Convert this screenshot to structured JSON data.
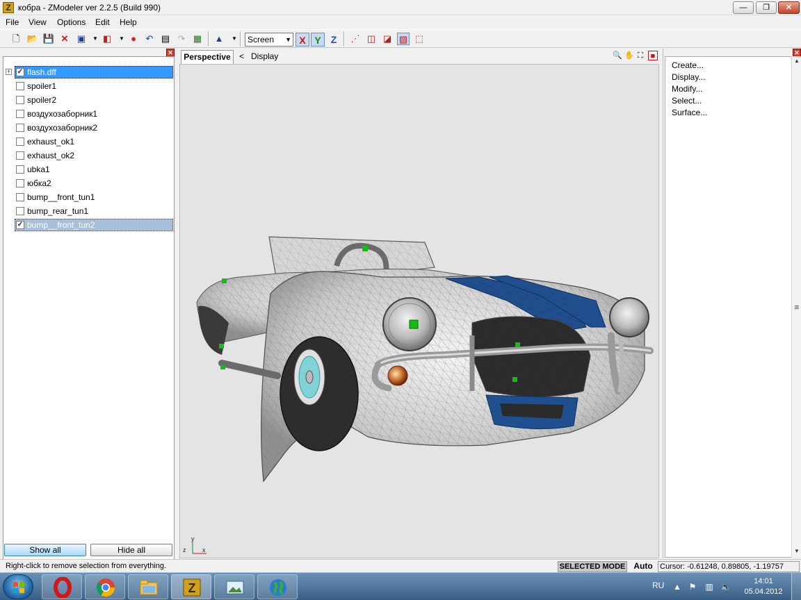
{
  "window": {
    "title": "кобра - ZModeler ver 2.2.5 (Build 990)",
    "app_icon_letter": "Z",
    "controls": {
      "minimize": "—",
      "maximize": "❐",
      "close": "✕"
    }
  },
  "menu": {
    "items": [
      {
        "label": "File"
      },
      {
        "label": "View"
      },
      {
        "label": "Options"
      },
      {
        "label": "Edit"
      },
      {
        "label": "Help"
      }
    ]
  },
  "toolbar": {
    "view_mode": "Screen",
    "axes": [
      "X",
      "Y",
      "Z"
    ]
  },
  "objects_panel": {
    "items": [
      {
        "label": "flash.dff",
        "checked": true,
        "expandable": true,
        "state": "selected"
      },
      {
        "label": "spoiler1",
        "checked": false,
        "expandable": false,
        "state": "none"
      },
      {
        "label": "spoiler2",
        "checked": false,
        "expandable": false,
        "state": "none"
      },
      {
        "label": "воздухозаборник1",
        "checked": false,
        "expandable": false,
        "state": "none"
      },
      {
        "label": "воздухозаборник2",
        "checked": false,
        "expandable": false,
        "state": "none"
      },
      {
        "label": "exhaust_ok1",
        "checked": false,
        "expandable": false,
        "state": "none"
      },
      {
        "label": "exhaust_ok2",
        "checked": false,
        "expandable": false,
        "state": "none"
      },
      {
        "label": "ubka1",
        "checked": false,
        "expandable": false,
        "state": "none"
      },
      {
        "label": "юбка2",
        "checked": false,
        "expandable": false,
        "state": "none"
      },
      {
        "label": "bump__front_tun1",
        "checked": false,
        "expandable": false,
        "state": "none"
      },
      {
        "label": "bump_rear_tun1",
        "checked": false,
        "expandable": false,
        "state": "none"
      },
      {
        "label": "bump__front_tun2",
        "checked": true,
        "expandable": false,
        "state": "highlighted"
      }
    ],
    "show_all_label": "Show all",
    "hide_all_label": "Hide all"
  },
  "viewport": {
    "tab_label": "Perspective",
    "back_label": "<",
    "breadcrumb": "Display",
    "gizmo_y": "y",
    "gizmo_z": "z",
    "gizmo_x": "x"
  },
  "command_panel": {
    "items": [
      {
        "label": "Create..."
      },
      {
        "label": "Display..."
      },
      {
        "label": "Modify..."
      },
      {
        "label": "Select..."
      },
      {
        "label": "Surface..."
      }
    ]
  },
  "status": {
    "hint": "Right-click to remove selection from everything.",
    "mode": "SELECTED MODE",
    "auto": "Auto",
    "cursor": "Cursor: -0.61248, 0.89805, -1.19757"
  },
  "taskbar": {
    "language": "RU",
    "time": "14:01",
    "date": "05.04.2012"
  },
  "colors": {
    "selection_blue": "#3399ff",
    "selection_gray": "#a7bfd9",
    "viewport_bg": "#e4e4e4",
    "car_stripe": "#1f4f8f",
    "helper_green": "#10c010"
  }
}
